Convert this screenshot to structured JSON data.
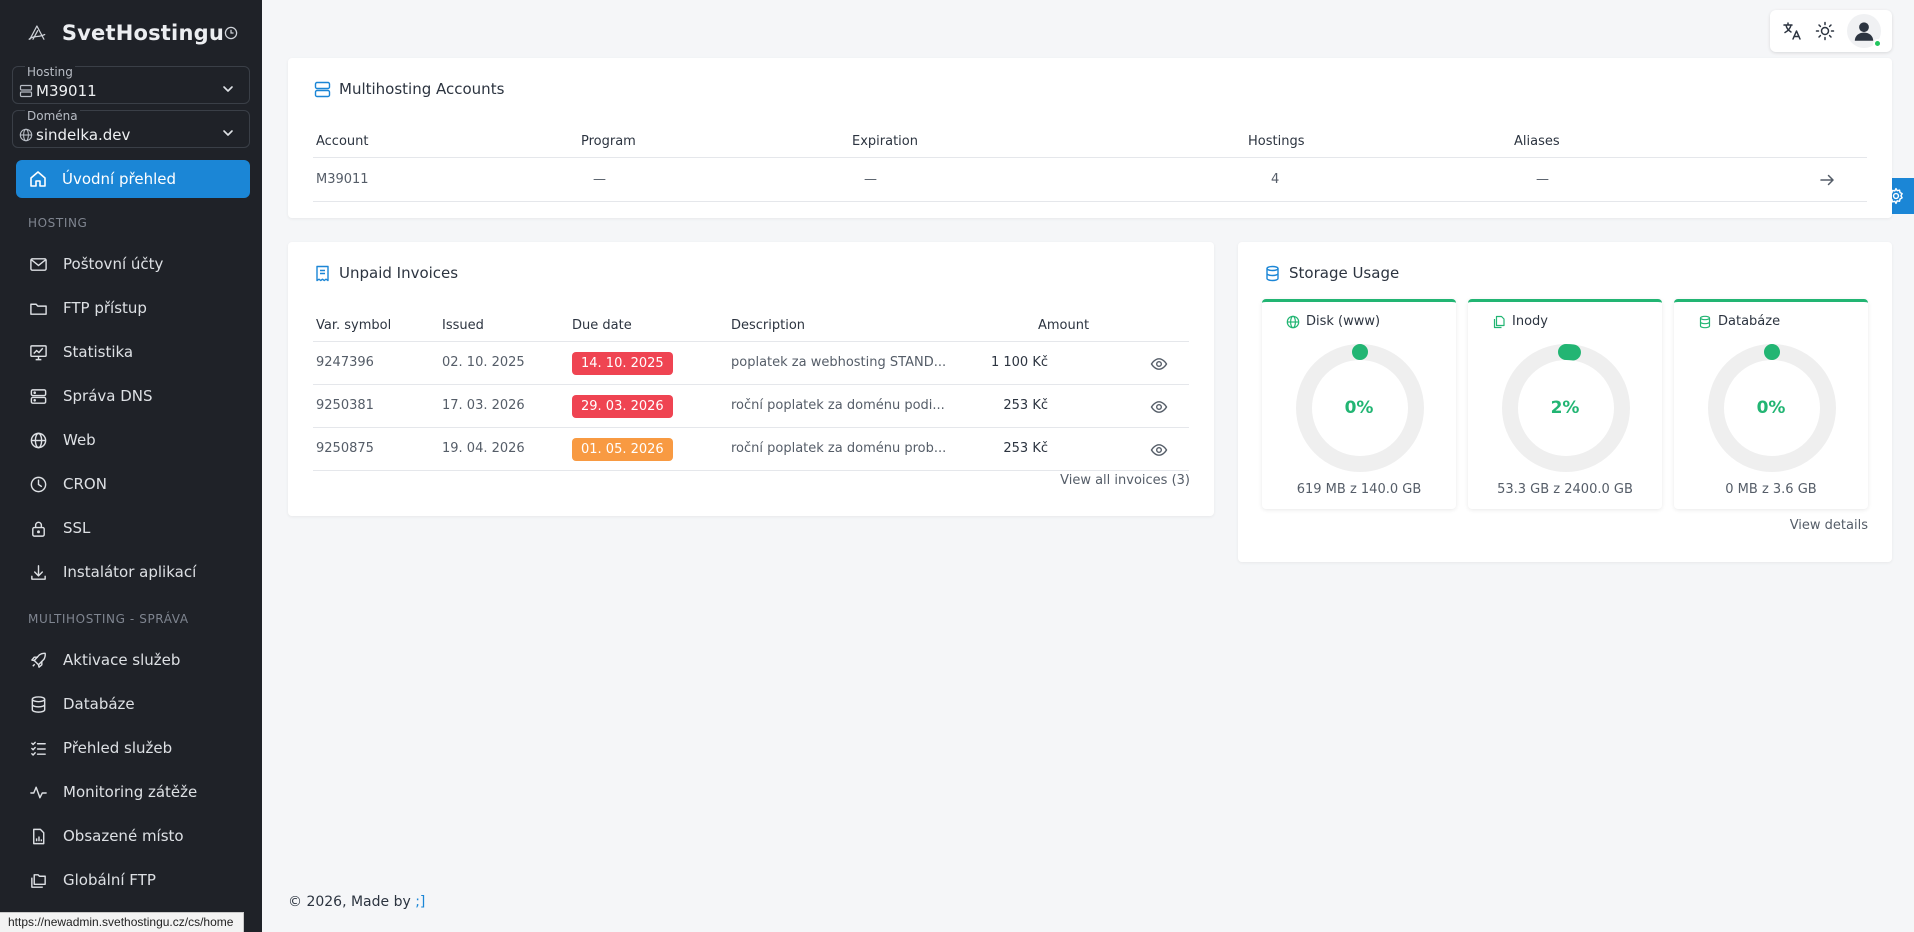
{
  "brand": {
    "name": "SvetHostingu"
  },
  "selectors": {
    "hosting": {
      "label": "Hosting",
      "value": "M39011"
    },
    "domain": {
      "label": "Doména",
      "value": "sindelka.dev"
    }
  },
  "nav": {
    "active": "Úvodní přehled",
    "section_hosting": "HOSTING",
    "hosting_items": [
      "Poštovní účty",
      "FTP přístup",
      "Statistika",
      "Správa DNS",
      "Web",
      "CRON",
      "SSL",
      "Instalátor aplikací"
    ],
    "section_multi": "MULTIHOSTING - SPRÁVA",
    "multi_items": [
      "Aktivace služeb",
      "Databáze",
      "Přehled služeb",
      "Monitoring zátěže",
      "Obsazené místo",
      "Globální FTP"
    ]
  },
  "status_url": "https://newadmin.svethostingu.cz/cs/home",
  "accounts": {
    "title": "Multihosting Accounts",
    "headers": [
      "Account",
      "Program",
      "Expiration",
      "Hostings",
      "Aliases"
    ],
    "row": [
      "M39011",
      "—",
      "—",
      "4",
      "—"
    ]
  },
  "invoices": {
    "title": "Unpaid Invoices",
    "headers": [
      "Var. symbol",
      "Issued",
      "Due date",
      "Description",
      "Amount"
    ],
    "rows": [
      {
        "symbol": "9247396",
        "issued": "02. 10. 2025",
        "due": "14. 10. 2025",
        "due_color": "#ef4452",
        "desc": "poplatek za webhosting STAND...",
        "amount": "1 100 Kč"
      },
      {
        "symbol": "9250381",
        "issued": "17. 03. 2026",
        "due": "29. 03. 2026",
        "due_color": "#ef4452",
        "desc": "roční poplatek za doménu podi...",
        "amount": "253 Kč"
      },
      {
        "symbol": "9250875",
        "issued": "19. 04. 2026",
        "due": "01. 05. 2026",
        "due_color": "#f89a42",
        "desc": "roční poplatek za doménu prob...",
        "amount": "253 Kč"
      }
    ],
    "view_all": "View all invoices (3)"
  },
  "storage": {
    "title": "Storage Usage",
    "stats": [
      {
        "label": "Disk (www)",
        "percent": "0%",
        "fraction": 0.0,
        "detail": "619 MB z 140.0 GB"
      },
      {
        "label": "Inody",
        "percent": "2%",
        "fraction": 0.02,
        "detail": "53.3 GB z 2400.0 GB"
      },
      {
        "label": "Databáze",
        "percent": "0%",
        "fraction": 0.0,
        "detail": "0 MB z 3.6 GB"
      }
    ],
    "view_details": "View details"
  },
  "footer": {
    "text": "© 2026, Made by ",
    "link": ";]"
  },
  "colors": {
    "accent": "#1b86d6",
    "success": "#22b573",
    "danger": "#ef4452",
    "warning": "#f89a42",
    "sidebar": "#1f2228"
  }
}
